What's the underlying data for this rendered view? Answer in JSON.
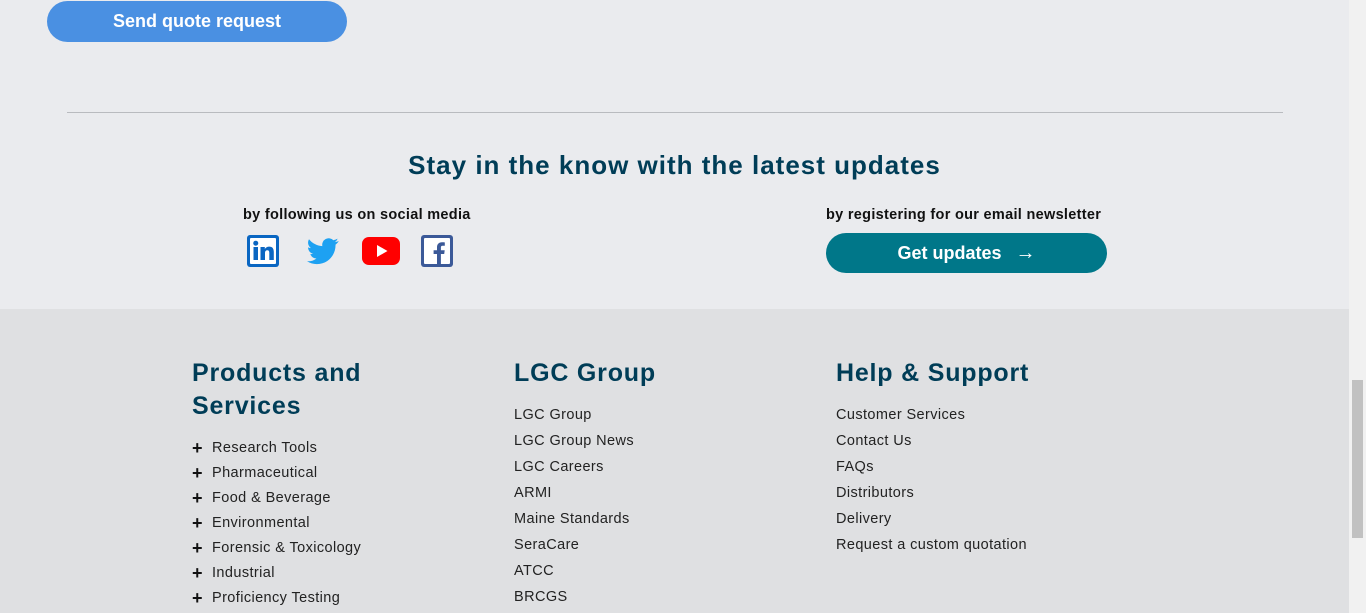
{
  "quote": {
    "button_label": "Send quote request"
  },
  "updates": {
    "title": "Stay in the know with the latest updates",
    "social_label": "by following us on social media",
    "social_icons": [
      "linkedin-icon",
      "twitter-icon",
      "youtube-icon",
      "facebook-icon"
    ],
    "newsletter_label": "by registering for our email newsletter",
    "button_label": "Get updates",
    "button_arrow": "→"
  },
  "footer": {
    "products": {
      "title": "Products and Services",
      "items": [
        "Research Tools",
        "Pharmaceutical",
        "Food & Beverage",
        "Environmental",
        "Forensic & Toxicology",
        "Industrial",
        "Proficiency Testing"
      ]
    },
    "group": {
      "title": "LGC Group",
      "items": [
        "LGC Group",
        "LGC Group News",
        "LGC Careers",
        "ARMI",
        "Maine Standards",
        "SeraCare",
        "ATCC",
        "BRCGS"
      ]
    },
    "support": {
      "title": "Help & Support",
      "items": [
        "Customer Services",
        "Contact Us",
        "FAQs",
        "Distributors",
        "Delivery",
        "Request a custom quotation"
      ]
    }
  },
  "colors": {
    "background": "#eaebee",
    "footer_bg": "#dfe0e2",
    "quote_button": "#4a90e2",
    "updates_button": "#007789",
    "heading": "#003d57"
  }
}
